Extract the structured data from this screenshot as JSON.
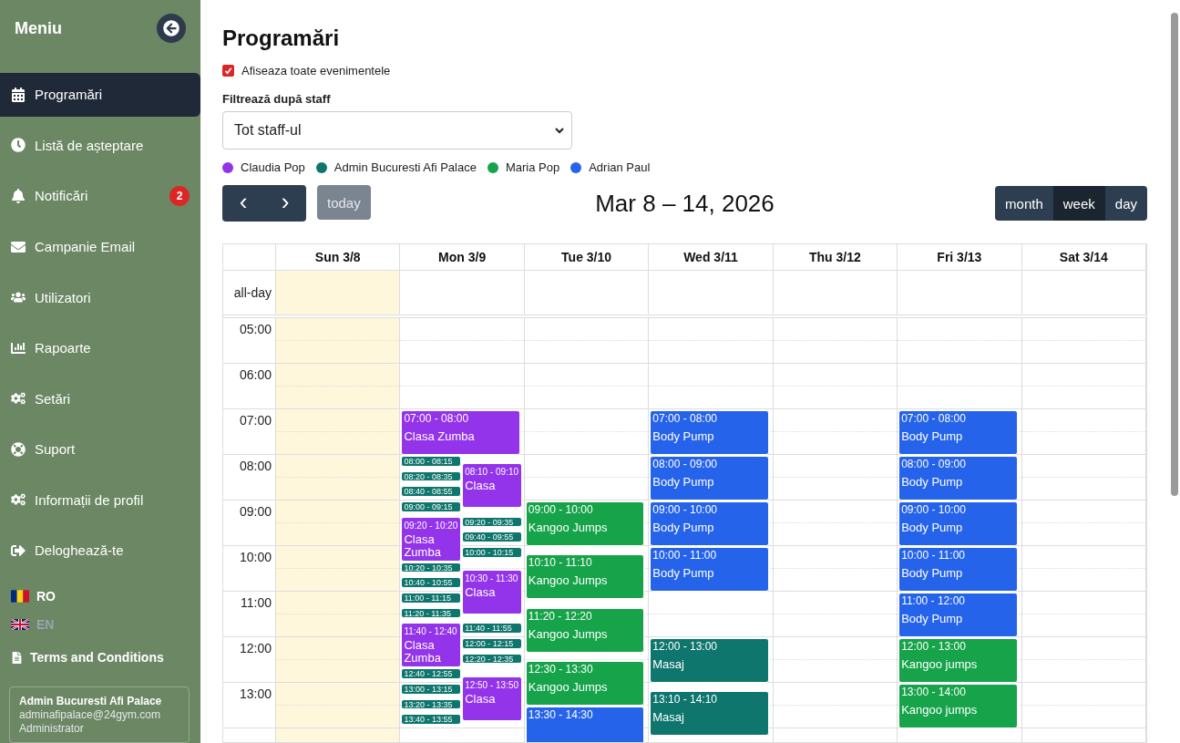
{
  "sidebar": {
    "title": "Meniu",
    "items": [
      {
        "label": "Programări",
        "selected": true
      },
      {
        "label": "Listă de așteptare",
        "selected": false
      },
      {
        "label": "Notificări",
        "selected": false,
        "badge": "2"
      },
      {
        "label": "Campanie Email",
        "selected": false
      },
      {
        "label": "Utilizatori",
        "selected": false
      },
      {
        "label": "Rapoarte",
        "selected": false
      },
      {
        "label": "Setări",
        "selected": false
      },
      {
        "label": "Suport",
        "selected": false
      },
      {
        "label": "Informații de profil",
        "selected": false
      },
      {
        "label": "Deloghează-te",
        "selected": false
      }
    ],
    "languages": [
      {
        "code": "RO",
        "selected": true
      },
      {
        "code": "EN",
        "selected": false
      }
    ],
    "terms": "Terms and Conditions",
    "user": {
      "name": "Admin Bucuresti Afi Palace",
      "email": "adminafipalace@24gym.com",
      "role": "Administrator"
    }
  },
  "page": {
    "title": "Programări",
    "show_all": {
      "label": "Afiseaza toate evenimentele",
      "checked": true
    },
    "filter": {
      "label": "Filtrează după staff",
      "value": "Tot staff-ul"
    },
    "legend": [
      {
        "name": "Claudia Pop",
        "color": "#9333ea"
      },
      {
        "name": "Admin Bucuresti Afi Palace",
        "color": "#0f766e"
      },
      {
        "name": "Maria Pop",
        "color": "#16a34a"
      },
      {
        "name": "Adrian Paul",
        "color": "#2563eb"
      }
    ]
  },
  "calendar": {
    "prev": "‹",
    "next": "›",
    "today": "today",
    "range": "Mar 8 – 14, 2026",
    "views": [
      {
        "label": "month",
        "selected": false
      },
      {
        "label": "week",
        "selected": true
      },
      {
        "label": "day",
        "selected": false
      }
    ],
    "allday_label": "all-day",
    "hours": [
      "05:00",
      "06:00",
      "07:00",
      "08:00",
      "09:00",
      "10:00",
      "11:00",
      "12:00",
      "13:00"
    ],
    "days": [
      {
        "label": "Sun 3/8",
        "today": true
      },
      {
        "label": "Mon 3/9",
        "today": false,
        "events": [
          {
            "time": "07:00 - 08:00",
            "title": "Clasa Zumba",
            "color": "#9333ea"
          },
          {
            "time": "08:00 - 08:15",
            "color": "#0f766e"
          },
          {
            "time": "08:20 - 08:35",
            "color": "#0f766e"
          },
          {
            "time": "08:40 - 08:55",
            "color": "#0f766e"
          },
          {
            "time": "09:00 - 09:15",
            "color": "#0f766e"
          },
          {
            "time": "09:20 - 10:20",
            "title": "Clasa Zumba",
            "color": "#9333ea"
          },
          {
            "time": "10:20 - 10:35",
            "color": "#0f766e"
          },
          {
            "time": "10:40 - 10:55",
            "color": "#0f766e"
          },
          {
            "time": "11:00 - 11:15",
            "color": "#0f766e"
          },
          {
            "time": "11:20 - 11:35",
            "color": "#0f766e"
          },
          {
            "time": "11:40 - 12:40",
            "title": "Clasa Zumba",
            "color": "#9333ea"
          },
          {
            "time": "12:40 - 12:55",
            "color": "#0f766e"
          },
          {
            "time": "13:00 - 13:15",
            "color": "#0f766e"
          },
          {
            "time": "13:20 - 13:35",
            "color": "#0f766e"
          },
          {
            "time": "13:40 - 13:55",
            "color": "#0f766e"
          },
          {
            "time": "08:10 - 09:10",
            "title": "Clasa",
            "color": "#9333ea"
          },
          {
            "time": "09:20 - 09:35",
            "color": "#0f766e"
          },
          {
            "time": "09:40 - 09:55",
            "color": "#0f766e"
          },
          {
            "time": "10:00 - 10:15",
            "color": "#0f766e"
          },
          {
            "time": "10:30 - 11:30",
            "title": "Clasa",
            "color": "#9333ea"
          },
          {
            "time": "11:40 - 11:55",
            "color": "#0f766e"
          },
          {
            "time": "12:00 - 12:15",
            "color": "#0f766e"
          },
          {
            "time": "12:20 - 12:35",
            "color": "#0f766e"
          },
          {
            "time": "12:50 - 13:50",
            "title": "Clasa",
            "color": "#9333ea"
          }
        ]
      },
      {
        "label": "Tue 3/10",
        "today": false,
        "events": [
          {
            "time": "09:00 - 10:00",
            "title": "Kangoo Jumps",
            "color": "#16a34a"
          },
          {
            "time": "10:10 - 11:10",
            "title": "Kangoo Jumps",
            "color": "#16a34a"
          },
          {
            "time": "11:20 - 12:20",
            "title": "Kangoo Jumps",
            "color": "#16a34a"
          },
          {
            "time": "12:30 - 13:30",
            "title": "Kangoo Jumps",
            "color": "#16a34a"
          },
          {
            "time": "13:30 - 14:30",
            "color": "#2563eb"
          }
        ]
      },
      {
        "label": "Wed 3/11",
        "today": false,
        "events": [
          {
            "time": "07:00 - 08:00",
            "title": "Body Pump",
            "color": "#2563eb"
          },
          {
            "time": "08:00 - 09:00",
            "title": "Body Pump",
            "color": "#2563eb"
          },
          {
            "time": "09:00 - 10:00",
            "title": "Body Pump",
            "color": "#2563eb"
          },
          {
            "time": "10:00 - 11:00",
            "title": "Body Pump",
            "color": "#2563eb"
          },
          {
            "time": "12:00 - 13:00",
            "title": "Masaj",
            "color": "#0f766e"
          },
          {
            "time": "13:10 - 14:10",
            "title": "Masaj",
            "color": "#0f766e"
          }
        ]
      },
      {
        "label": "Thu 3/12",
        "today": false
      },
      {
        "label": "Fri 3/13",
        "today": false,
        "events": [
          {
            "time": "07:00 - 08:00",
            "title": "Body Pump",
            "color": "#2563eb"
          },
          {
            "time": "08:00 - 09:00",
            "title": "Body Pump",
            "color": "#2563eb"
          },
          {
            "time": "09:00 - 10:00",
            "title": "Body Pump",
            "color": "#2563eb"
          },
          {
            "time": "10:00 - 11:00",
            "title": "Body Pump",
            "color": "#2563eb"
          },
          {
            "time": "11:00 - 12:00",
            "title": "Body Pump",
            "color": "#2563eb"
          },
          {
            "time": "12:00 - 13:00",
            "title": "Kangoo jumps",
            "color": "#16a34a"
          },
          {
            "time": "13:00 - 14:00",
            "title": "Kangoo jumps",
            "color": "#16a34a"
          }
        ]
      },
      {
        "label": "Sat 3/14",
        "today": false
      }
    ]
  }
}
